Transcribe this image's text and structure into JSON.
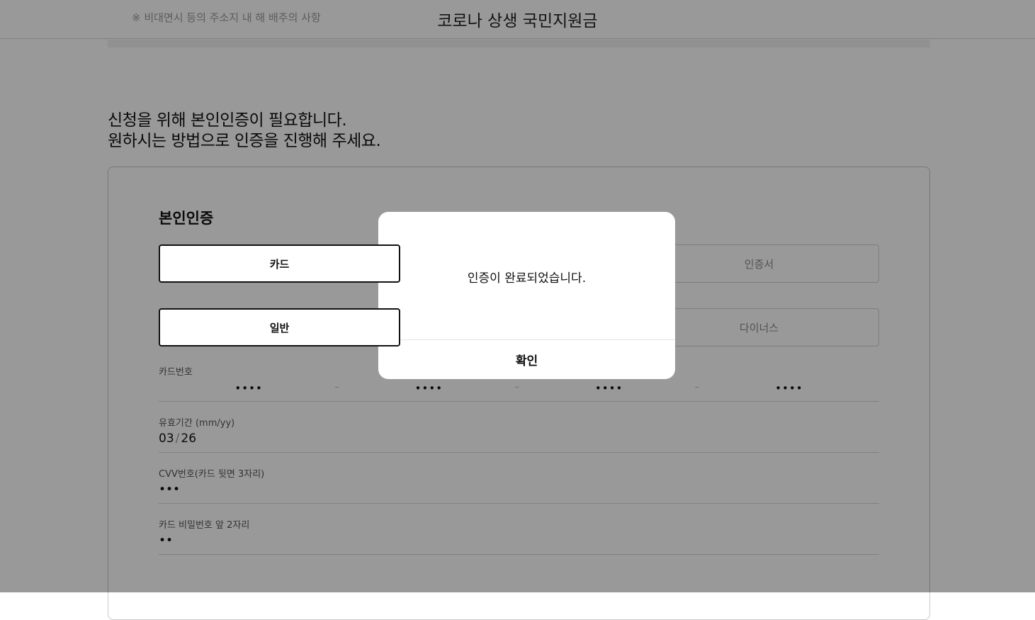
{
  "header": {
    "title": "코로나 상생 국민지원금",
    "ghost_text": "※ 비대면시 등의 주소지 내 해 배주의 사항"
  },
  "intro": {
    "line1": "신청을 위해 본인인증이 필요합니다.",
    "line2": "원하시는 방법으로 인증을 진행해 주세요."
  },
  "auth": {
    "section_title": "본인인증",
    "method_tabs": [
      {
        "label": "카드",
        "active": true
      },
      {
        "label": "",
        "active": false
      },
      {
        "label": "인증서",
        "active": false
      }
    ],
    "card_type_tabs": [
      {
        "label": "일반",
        "active": true
      },
      {
        "label": "",
        "active": false
      },
      {
        "label": "다이너스",
        "active": false
      }
    ],
    "card_number": {
      "label": "카드번호",
      "segments": [
        "••••",
        "••••",
        "••••",
        "••••"
      ],
      "separator": "–"
    },
    "expiry": {
      "label": "유효기간 (mm/yy)",
      "month": "03",
      "separator": "/",
      "year": "26"
    },
    "cvv": {
      "label": "CVV번호(카드 뒷면 3자리)",
      "value": "•••"
    },
    "pin": {
      "label": "카드 비밀번호 앞 2자리",
      "value": "••"
    }
  },
  "dialog": {
    "message": "인증이 완료되었습니다.",
    "confirm_label": "확인"
  },
  "colors": {
    "overlay": "#000000",
    "active_border": "#111111",
    "inactive_text": "#8a8a8a"
  }
}
